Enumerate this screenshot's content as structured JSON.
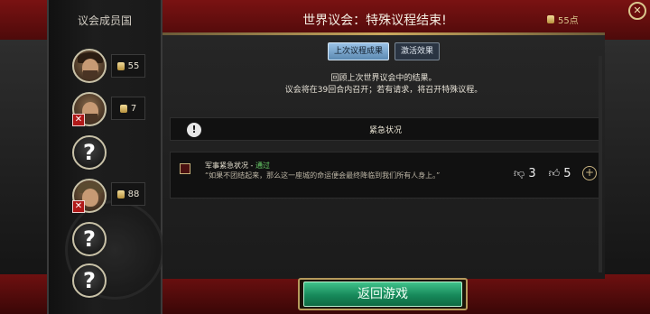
{
  "header": {
    "title": "世界议会：特殊议程结束!",
    "favor": "55点",
    "close_icon": "close-icon"
  },
  "sidebar": {
    "title": "议会成员国",
    "members": [
      {
        "type": "leader",
        "votes": "55",
        "denied": false
      },
      {
        "type": "leader",
        "votes": "7",
        "denied": true
      },
      {
        "type": "unknown",
        "label": "?"
      },
      {
        "type": "leader",
        "votes": "88",
        "denied": true
      },
      {
        "type": "unknown",
        "label": "?"
      },
      {
        "type": "unknown",
        "label": "?"
      }
    ]
  },
  "tabs": [
    {
      "label": "上次议程成果",
      "active": true
    },
    {
      "label": "激活效果",
      "active": false
    }
  ],
  "info": {
    "line1": "回顾上次世界议会中的结果。",
    "line2": "议会将在39回合内召开；若有请求，将召开特殊议程。"
  },
  "section": {
    "title": "紧急状况",
    "icon": "warning-icon"
  },
  "proposal": {
    "title": "军事紧急状况 - ",
    "status": "通过",
    "quote": "“如果不团结起来，那么这一座城的命运便会最终降临到我们所有人身上。”",
    "votes_against": "3",
    "votes_for": "5"
  },
  "bottom": {
    "return_label": "返回游戏"
  },
  "colors": {
    "accent_gold": "#c9a85e",
    "status_green": "#6bd46b",
    "button_green": "#17895a",
    "tab_active": "#9ac2e6",
    "background_red": "#5c0d0d"
  }
}
